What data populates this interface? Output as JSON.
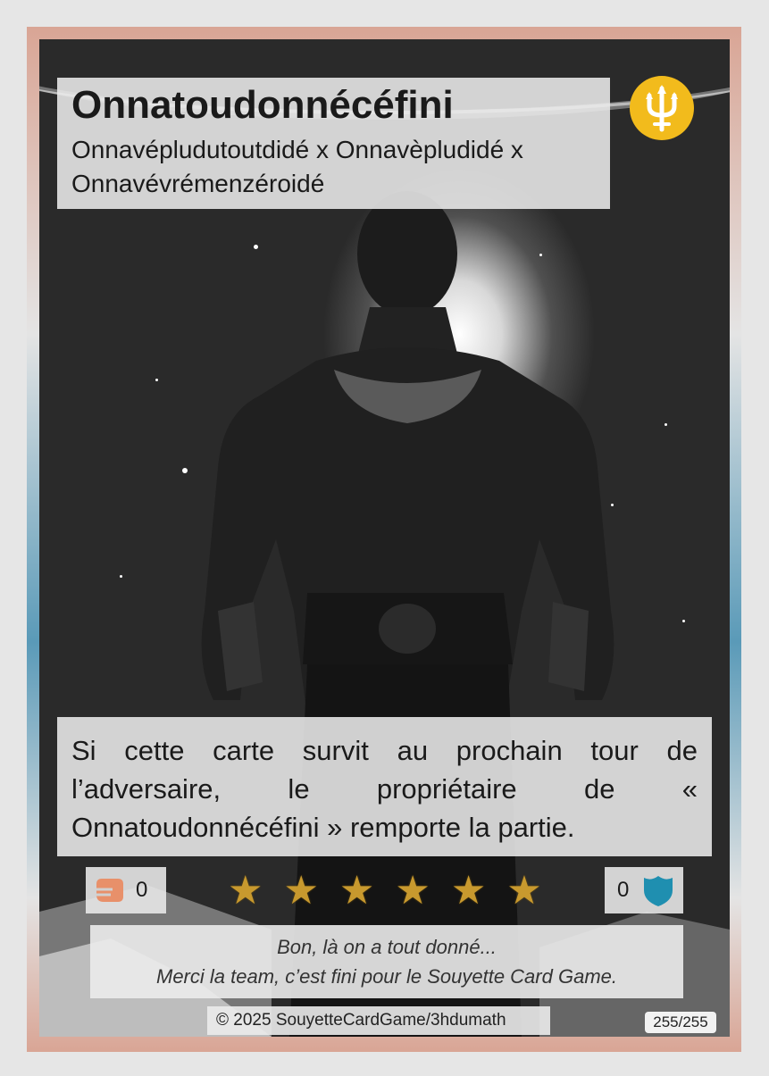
{
  "card": {
    "title": "Onnatoudonnécéfini",
    "subtitle": "Onnavépludutoutdidé x Onnavèpludidé x Onnavévrémenzéroidé",
    "effect": "Si cette carte survit au prochain tour de l’adversaire, le propriétaire de « Onnatoudonnécéfini » remporte la partie.",
    "attack": "0",
    "defense": "0",
    "stars": [
      "★",
      "★",
      "★",
      "★",
      "★",
      "★"
    ],
    "quote_line1": "Bon, là on a tout donné...",
    "quote_line2": "Merci la team, c’est fini pour le Souyette Card Game.",
    "copyright": "© 2025 SouyetteCardGame/3hdumath",
    "card_number": "255/255"
  },
  "icons": {
    "emblem": "trident-icon",
    "attack": "fist-icon",
    "defense": "shield-icon"
  },
  "colors": {
    "emblem": "#f2bb1c",
    "attack_icon": "#e8906a",
    "defense_icon": "#1f8fb0",
    "stars": "#c8992e"
  }
}
